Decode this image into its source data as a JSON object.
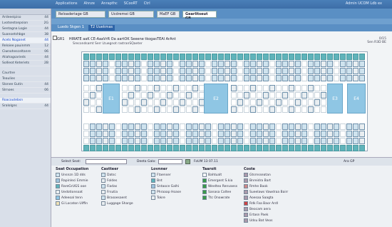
{
  "menu": [
    "Applications",
    "Ahnze",
    "Anrapthc",
    "SCooRT",
    "Ctrl"
  ],
  "user_link": "Admin UCOM Ldb ex",
  "tabs": [
    {
      "label": "Reloaderiage GB",
      "active": false
    },
    {
      "label": "Ucdremei GB",
      "active": false
    },
    {
      "label": "MaEF GB",
      "active": false
    },
    {
      "label": "Gearlitseut GB",
      "active": true
    }
  ],
  "subtabs": [
    {
      "label": "Luedo Skgen 1",
      "active": false
    },
    {
      "label": "T2 Uuekmas",
      "active": true
    }
  ],
  "sidebar": {
    "items": [
      {
        "label": "Ardeeeipiso",
        "value": "44",
        "hl": false
      },
      {
        "label": "Lvotsestsepsion",
        "value": "2G",
        "hl": false
      },
      {
        "label": "Sentagna Logie",
        "value": "44",
        "hl": false
      },
      {
        "label": "Suanoetshbge",
        "value": "38",
        "hl": false
      },
      {
        "label": "Acets Noganet",
        "value": "44",
        "hl": true
      },
      {
        "label": "Reloiee pauinmm",
        "value": "12",
        "hl": false
      },
      {
        "label": "Ciwnohesceltanre",
        "value": "06",
        "hl": false
      },
      {
        "label": "Aliahagsarieds",
        "value": "44",
        "hl": false
      },
      {
        "label": "Sollieot Keteriets",
        "value": "2B",
        "hl": false
      },
      {
        "label": "Caurtne",
        "value": "",
        "hl": false
      },
      {
        "label": "Teaulies",
        "value": "",
        "hl": false
      },
      {
        "label": "Slonee Gutin",
        "value": "44",
        "hl": false
      },
      {
        "label": "Slrnoes",
        "value": "06",
        "hl": false
      },
      {
        "label": "Roacoutebsn",
        "value": "",
        "hl": true
      },
      {
        "label": "Sralolgns",
        "value": "44",
        "hl": false
      }
    ]
  },
  "page": {
    "ref": "GR1",
    "title": "HIRATE aaK CE-AaaVrR Oa aartOK Seeene tkogasTEAl ArAnt",
    "subtitle": "Srecondsamt Serr  Ltuegnot rastranSQaeter",
    "right_1": "0/15",
    "right_2": "Sen R3D BE"
  },
  "grid": {
    "blocks": [
      "E1",
      "E2",
      "E3",
      "E4"
    ]
  },
  "selectbar": {
    "label_1": "Select Seat:",
    "label_2": "Deeta Galo:",
    "info": "FoUM 13 07.11",
    "right_label": "Ara GP"
  },
  "legend": {
    "columns": [
      {
        "head": "Seat Occupation",
        "items": [
          {
            "label": "Unsnzn 1D dds",
            "color": "#cfe3ee"
          },
          {
            "label": "Rapinleci Emmie",
            "color": "#9fc4dd"
          },
          {
            "label": "RareGrUGS ooe",
            "color": "#5fb3ba"
          },
          {
            "label": "Uedotionsoat",
            "color": "#e9eef1"
          },
          {
            "label": "Adeeoal tenn",
            "color": "#8fc6e4"
          },
          {
            "label": "Gi Locaton Uiffin",
            "color": "#f0e2b6"
          }
        ]
      },
      {
        "head": "Castteer",
        "items": [
          {
            "label": "Datsc",
            "color": "#cfe3ee"
          },
          {
            "label": "Foldes",
            "color": "#e9eef1"
          },
          {
            "label": "Fiadas",
            "color": "#cfe3ee"
          },
          {
            "label": "Frsutia",
            "color": "#e9eef1"
          },
          {
            "label": "Brasoesaent",
            "color": "#cfe3ee"
          },
          {
            "label": "Luggage Sharge",
            "color": "#e9eef1"
          }
        ]
      },
      {
        "head": "Lovnner",
        "items": [
          {
            "label": "Ftaenser",
            "color": "#cfe3ee"
          },
          {
            "label": "Bnt",
            "color": "#5fb3ba"
          },
          {
            "label": "Sntaoce Galhi",
            "color": "#9fc4dd"
          },
          {
            "label": "Phraaap Hoase",
            "color": "#cfe3ee"
          },
          {
            "label": "Tokre",
            "color": "#e9eef1"
          }
        ]
      },
      {
        "head": "Taaroit",
        "items": [
          {
            "label": "Bahtualt",
            "color": "#fff"
          },
          {
            "label": "Emergent S.kia",
            "color": "#3a9a4a"
          },
          {
            "label": "Weelteo Renvaess",
            "color": "#3a9a4a"
          },
          {
            "label": "Sanasa Caltee",
            "color": "#3a9a4a"
          },
          {
            "label": "Ttc Onowrate",
            "color": "#3a9a4a"
          }
        ]
      },
      {
        "head": "Coste",
        "items": [
          {
            "label": "Gtsrnsseatan",
            "color": "#a9a"
          },
          {
            "label": "Bnreidra Bart",
            "color": "#a9a"
          },
          {
            "label": "Rmhe Baok",
            "color": "#c88"
          },
          {
            "label": "Sueelaws Vawdraa Bairr",
            "color": "#a9a"
          },
          {
            "label": "Aoesaa Saagta",
            "color": "#a9a"
          },
          {
            "label": "Rdk Faa Baor Ardl",
            "color": "#c44"
          },
          {
            "label": "Beocam aera",
            "color": "#a9a"
          },
          {
            "label": "Ertasn Paek",
            "color": "#a9a"
          },
          {
            "label": "Udsu Bat Veos",
            "color": "#a9a"
          }
        ]
      }
    ]
  },
  "colors": {
    "header_blue": "#5a8fc4",
    "seat_teal": "#5fb3ba",
    "seat_light": "#cfe3ee",
    "block_blue": "#8fc6e4"
  }
}
